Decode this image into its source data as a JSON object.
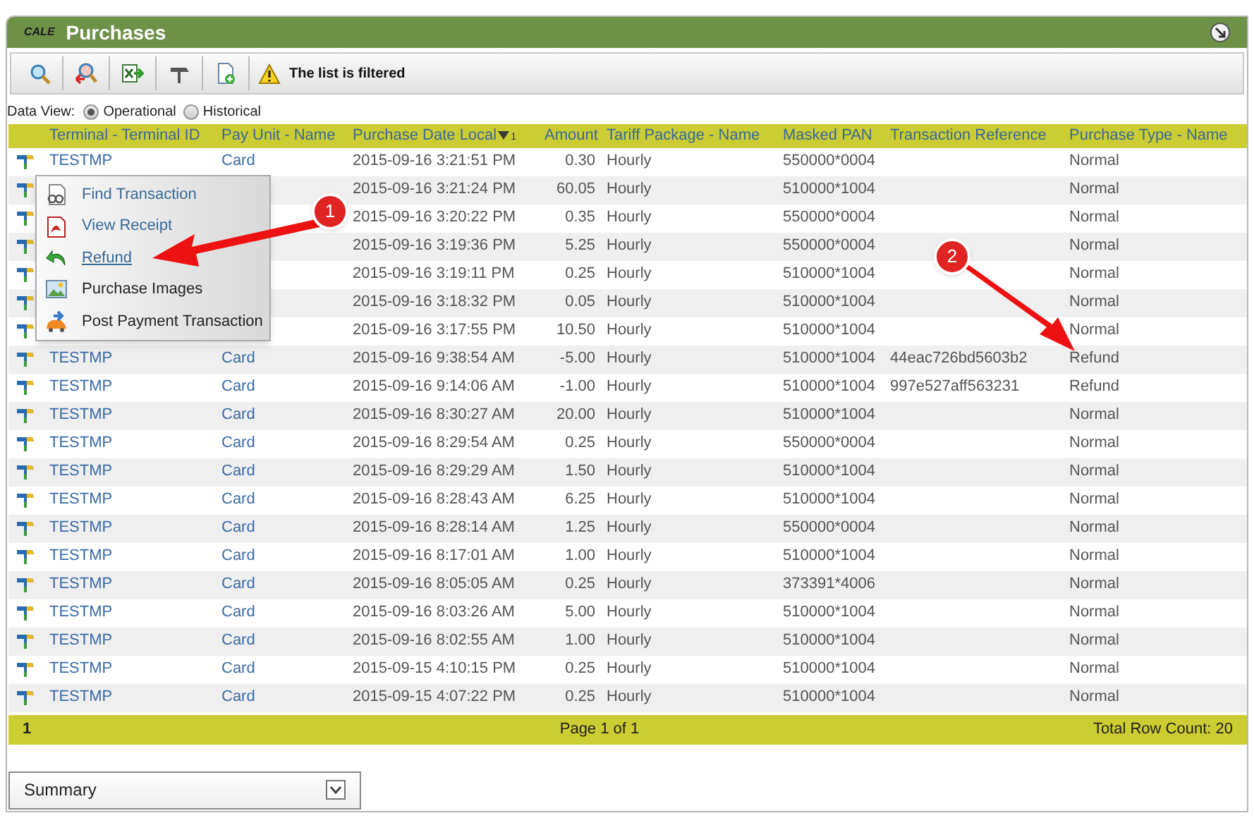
{
  "panel": {
    "logo": "CALE",
    "title": "Purchases"
  },
  "toolbar": {
    "buttons": [
      {
        "kind": "search"
      },
      {
        "kind": "clear"
      },
      {
        "kind": "export"
      },
      {
        "kind": "tool"
      },
      {
        "kind": "add"
      }
    ],
    "notice": "The list is filtered"
  },
  "data_view": {
    "label": "Data View:",
    "options": [
      {
        "label": "Operational",
        "selected": true
      },
      {
        "label": "Historical",
        "selected": false
      }
    ]
  },
  "table": {
    "columns": [
      {
        "label": "Terminal - Terminal ID"
      },
      {
        "label": "Pay Unit - Name"
      },
      {
        "label": "Purchase Date Local",
        "sorted": true,
        "sort_rank": "1"
      },
      {
        "label": "Amount"
      },
      {
        "label": "Tariff Package - Name"
      },
      {
        "label": "Masked PAN"
      },
      {
        "label": "Transaction Reference"
      },
      {
        "label": "Purchase Type - Name"
      }
    ],
    "rows": [
      [
        "TESTMP",
        "Card",
        "2015-09-16 3:21:51 PM",
        "0.30",
        "Hourly",
        "550000*0004",
        "",
        "Normal"
      ],
      [
        null,
        null,
        "2015-09-16 3:21:24 PM",
        "60.05",
        "Hourly",
        "510000*1004",
        null,
        "Normal"
      ],
      [
        null,
        null,
        "2015-09-16 3:20:22 PM",
        "0.35",
        "Hourly",
        "550000*0004",
        null,
        "Normal"
      ],
      [
        null,
        null,
        "2015-09-16 3:19:36 PM",
        "5.25",
        "Hourly",
        "550000*0004",
        null,
        "Normal"
      ],
      [
        null,
        null,
        "2015-09-16 3:19:11 PM",
        "0.25",
        "Hourly",
        "510000*1004",
        null,
        "Normal"
      ],
      [
        null,
        null,
        "2015-09-16 3:18:32 PM",
        "0.05",
        "Hourly",
        "510000*1004",
        null,
        "Normal"
      ],
      [
        null,
        null,
        "2015-09-16 3:17:55 PM",
        "10.50",
        "Hourly",
        "510000*1004",
        null,
        "Normal"
      ],
      [
        "TESTMP",
        "Card",
        "2015-09-16 9:38:54 AM",
        "-5.00",
        "Hourly",
        "510000*1004",
        "44eac726bd5603b2",
        "Refund"
      ],
      [
        "TESTMP",
        "Card",
        "2015-09-16 9:14:06 AM",
        "-1.00",
        "Hourly",
        "510000*1004",
        "997e527aff563231",
        "Refund"
      ],
      [
        "TESTMP",
        "Card",
        "2015-09-16 8:30:27 AM",
        "20.00",
        "Hourly",
        "510000*1004",
        "",
        "Normal"
      ],
      [
        "TESTMP",
        "Card",
        "2015-09-16 8:29:54 AM",
        "0.25",
        "Hourly",
        "550000*0004",
        "",
        "Normal"
      ],
      [
        "TESTMP",
        "Card",
        "2015-09-16 8:29:29 AM",
        "1.50",
        "Hourly",
        "510000*1004",
        "",
        "Normal"
      ],
      [
        "TESTMP",
        "Card",
        "2015-09-16 8:28:43 AM",
        "6.25",
        "Hourly",
        "510000*1004",
        "",
        "Normal"
      ],
      [
        "TESTMP",
        "Card",
        "2015-09-16 8:28:14 AM",
        "1.25",
        "Hourly",
        "550000*0004",
        "",
        "Normal"
      ],
      [
        "TESTMP",
        "Card",
        "2015-09-16 8:17:01 AM",
        "1.00",
        "Hourly",
        "510000*1004",
        "",
        "Normal"
      ],
      [
        "TESTMP",
        "Card",
        "2015-09-16 8:05:05 AM",
        "0.25",
        "Hourly",
        "373391*4006",
        "",
        "Normal"
      ],
      [
        "TESTMP",
        "Card",
        "2015-09-16 8:03:26 AM",
        "5.00",
        "Hourly",
        "510000*1004",
        "",
        "Normal"
      ],
      [
        "TESTMP",
        "Card",
        "2015-09-16 8:02:55 AM",
        "1.00",
        "Hourly",
        "510000*1004",
        "",
        "Normal"
      ],
      [
        "TESTMP",
        "Card",
        "2015-09-15 4:10:15 PM",
        "0.25",
        "Hourly",
        "510000*1004",
        "",
        "Normal"
      ],
      [
        "TESTMP",
        "Card",
        "2015-09-15 4:07:22 PM",
        "0.25",
        "Hourly",
        "510000*1004",
        "",
        "Normal"
      ]
    ],
    "footer": {
      "page_number": "1",
      "pages": "Page 1 of 1",
      "total": "Total Row Count: 20"
    }
  },
  "context_menu": {
    "items": [
      {
        "label": "Find Transaction",
        "kind": "find",
        "hovered": false
      },
      {
        "label": "View Receipt",
        "kind": "receipt",
        "hovered": false
      },
      {
        "label": "Refund",
        "kind": "refund",
        "hovered": true
      },
      {
        "label": "Purchase Images",
        "kind": "images",
        "hovered": false
      },
      {
        "label": "Post Payment Transaction",
        "kind": "post",
        "hovered": false
      }
    ]
  },
  "summary_select": {
    "value": "Summary"
  },
  "callouts": [
    {
      "number": "1"
    },
    {
      "number": "2"
    }
  ]
}
